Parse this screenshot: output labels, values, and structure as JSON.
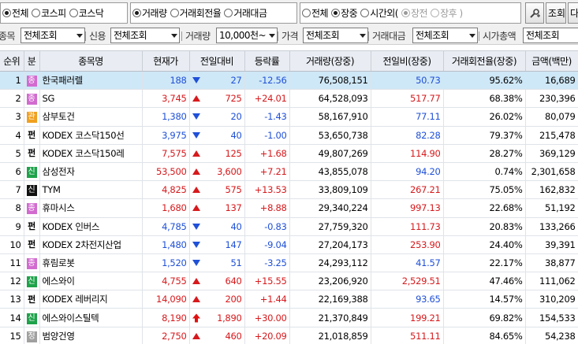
{
  "radio_groups": {
    "market": [
      {
        "label": "전체",
        "selected": true
      },
      {
        "label": "코스피",
        "selected": false
      },
      {
        "label": "코스닥",
        "selected": false
      }
    ],
    "sort_by": [
      {
        "label": "거래량",
        "selected": true
      },
      {
        "label": "거래회전율",
        "selected": false
      },
      {
        "label": "거래대금",
        "selected": false
      }
    ],
    "session": [
      {
        "label": "전체",
        "selected": false
      },
      {
        "label": "장중",
        "selected": true
      },
      {
        "label": "시간외(",
        "selected": false
      },
      {
        "label": "장전",
        "selected": true,
        "disabled": true
      },
      {
        "label": "장후 )",
        "selected": false,
        "disabled": true
      }
    ]
  },
  "toolbar": {
    "settings_icon": "wrench-plus-icon",
    "search_label": "조회",
    "next_label": "다"
  },
  "filters": {
    "item_label": "종목",
    "item_value": "전체조회",
    "credit_label": "신용",
    "credit_value": "전체조회",
    "volume_label": "거래량",
    "volume_value": "10,000천~1",
    "price_label": "가격",
    "price_value": "전체조회",
    "amount_label": "거래대금",
    "amount_value": "전체조회",
    "cap_label": "시가총액",
    "cap_value": "전체조회"
  },
  "table": {
    "headers": [
      "순위",
      "분",
      "종목명",
      "현재가",
      "전일대비",
      "등락률",
      "거래량(장중)",
      "전일비(장중)",
      "거래회전율(장중)",
      "금액(백만)"
    ],
    "rows": [
      {
        "rank": "1",
        "badge": "종",
        "badge_color": "pink",
        "name": "한국패러렐",
        "price": "188",
        "dir": "down",
        "change": "27",
        "rate": "-12.56",
        "volume": "76,508,151",
        "vol_ratio": "50.73",
        "ratio_dir": "down",
        "turnover": "95.62%",
        "amount": "16,689",
        "selected": true
      },
      {
        "rank": "2",
        "badge": "종",
        "badge_color": "pink",
        "name": "SG",
        "price": "3,745",
        "dir": "up",
        "change": "725",
        "rate": "+24.01",
        "volume": "64,528,093",
        "vol_ratio": "517.77",
        "ratio_dir": "up",
        "turnover": "68.38%",
        "amount": "230,396"
      },
      {
        "rank": "3",
        "badge": "관",
        "badge_color": "orange",
        "name": "삼부토건",
        "price": "1,380",
        "dir": "down",
        "change": "20",
        "rate": "-1.43",
        "volume": "58,167,910",
        "vol_ratio": "77.11",
        "ratio_dir": "down",
        "turnover": "26.02%",
        "amount": "80,079"
      },
      {
        "rank": "4",
        "badge": "펀",
        "badge_color": "etf",
        "name": "KODEX 코스닥150선",
        "price": "3,975",
        "dir": "down",
        "change": "40",
        "rate": "-1.00",
        "volume": "53,650,738",
        "vol_ratio": "82.28",
        "ratio_dir": "down",
        "turnover": "79.37%",
        "amount": "215,478"
      },
      {
        "rank": "5",
        "badge": "펀",
        "badge_color": "etf",
        "name": "KODEX 코스닥150레",
        "price": "7,575",
        "dir": "up",
        "change": "125",
        "rate": "+1.68",
        "volume": "49,807,269",
        "vol_ratio": "114.90",
        "ratio_dir": "up",
        "turnover": "28.27%",
        "amount": "369,129"
      },
      {
        "rank": "6",
        "badge": "신",
        "badge_color": "green",
        "name": "삼성전자",
        "price": "53,500",
        "dir": "up",
        "change": "3,600",
        "rate": "+7.21",
        "volume": "43,855,078",
        "vol_ratio": "94.20",
        "ratio_dir": "down",
        "turnover": "0.74%",
        "amount": "2,301,658"
      },
      {
        "rank": "7",
        "badge": "신",
        "badge_color": "black",
        "name": "TYM",
        "price": "4,825",
        "dir": "up",
        "change": "575",
        "rate": "+13.53",
        "volume": "33,809,109",
        "vol_ratio": "267.21",
        "ratio_dir": "up",
        "turnover": "75.05%",
        "amount": "162,832"
      },
      {
        "rank": "8",
        "badge": "종",
        "badge_color": "pink",
        "name": "휴마시스",
        "price": "1,680",
        "dir": "up",
        "change": "137",
        "rate": "+8.88",
        "volume": "29,340,224",
        "vol_ratio": "997.13",
        "ratio_dir": "up",
        "turnover": "22.68%",
        "amount": "51,192"
      },
      {
        "rank": "9",
        "badge": "펀",
        "badge_color": "etf",
        "name": "KODEX 인버스",
        "price": "4,785",
        "dir": "down",
        "change": "40",
        "rate": "-0.83",
        "volume": "27,759,320",
        "vol_ratio": "111.73",
        "ratio_dir": "up",
        "turnover": "20.83%",
        "amount": "133,266"
      },
      {
        "rank": "10",
        "badge": "펀",
        "badge_color": "etf",
        "name": "KODEX 2차전지산업",
        "price": "1,480",
        "dir": "down",
        "change": "147",
        "rate": "-9.04",
        "volume": "27,204,173",
        "vol_ratio": "253.90",
        "ratio_dir": "up",
        "turnover": "24.40%",
        "amount": "39,391"
      },
      {
        "rank": "11",
        "badge": "종",
        "badge_color": "pink",
        "name": "휴림로봇",
        "price": "1,520",
        "dir": "down",
        "change": "51",
        "rate": "-3.25",
        "volume": "24,293,112",
        "vol_ratio": "41.57",
        "ratio_dir": "down",
        "turnover": "22.17%",
        "amount": "38,877"
      },
      {
        "rank": "12",
        "badge": "신",
        "badge_color": "green",
        "name": "에스와이",
        "price": "4,755",
        "dir": "up",
        "change": "640",
        "rate": "+15.55",
        "volume": "23,206,920",
        "vol_ratio": "2,529.51",
        "ratio_dir": "up",
        "turnover": "47.46%",
        "amount": "111,062"
      },
      {
        "rank": "13",
        "badge": "펀",
        "badge_color": "etf",
        "name": "KODEX 레버리지",
        "price": "14,090",
        "dir": "up",
        "change": "200",
        "rate": "+1.44",
        "volume": "22,169,388",
        "vol_ratio": "93.65",
        "ratio_dir": "down",
        "turnover": "14.57%",
        "amount": "310,209"
      },
      {
        "rank": "14",
        "badge": "신",
        "badge_color": "green",
        "name": "에스와이스틸텍",
        "price": "8,190",
        "dir": "limit",
        "change": "1,890",
        "rate": "+30.00",
        "volume": "21,370,849",
        "vol_ratio": "199.21",
        "ratio_dir": "up",
        "turnover": "69.82%",
        "amount": "154,533"
      },
      {
        "rank": "15",
        "badge": "정",
        "badge_color": "gray",
        "name": "범양건영",
        "price": "2,750",
        "dir": "up",
        "change": "460",
        "rate": "+20.09",
        "volume": "21,018,859",
        "vol_ratio": "511.11",
        "ratio_dir": "up",
        "turnover": "84.65%",
        "amount": "54,238"
      }
    ]
  },
  "colors": {
    "up": "#d7191c",
    "down": "#1f50d8",
    "selected_row": "#cfe8f7",
    "header_bg": "#e9edf3",
    "limit_up": "#e01010"
  }
}
